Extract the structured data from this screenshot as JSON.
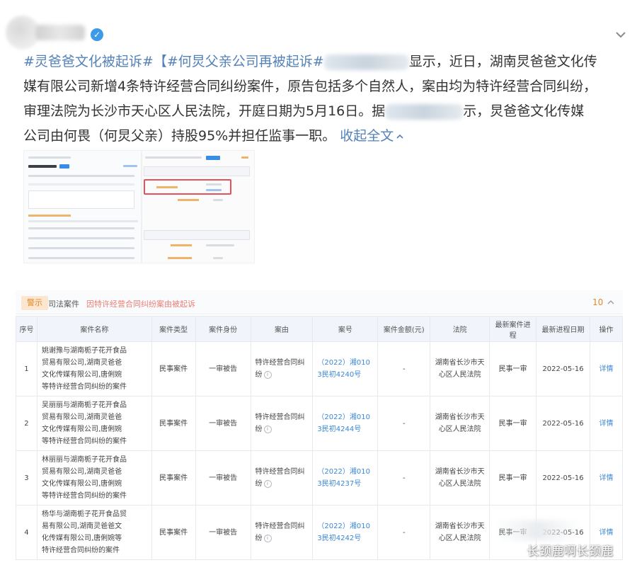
{
  "post": {
    "line1_tag1": "#灵爸爸文化被起诉#",
    "line1_tag2": "【#何炅父亲公司再被起诉#",
    "line1_tail": "显示，近日，湖南炅爸爸文化传",
    "line2": "媒有限公司新增4条特许经营合同纠纷案件，原告包括多个自然人，案由均为特许经营合同纠纷，",
    "line3_head": "审理法院为长沙市天心区人民法院，开庭日期为5月16日。据",
    "line3_tail": "示，炅爸爸文化传媒",
    "line4": "公司由何畏（何炅父亲）持股95%并担任监事一职。",
    "fold_label": "收起全文"
  },
  "header": {
    "verified_icon": "verified-v-icon",
    "expand_icon": "chevron-down-icon"
  },
  "shot": {
    "tab_badge": "警示",
    "tab_1": "司法案件",
    "tab_2": "因特许经营合同纠纷案由被起诉",
    "count": "10",
    "columns": [
      "序号",
      "案件名称",
      "案件类型",
      "案件身份",
      "案由",
      "案号",
      "案件金额(元)",
      "法院",
      "最新案件进程",
      "最新进程日期",
      "操作"
    ],
    "rows": [
      {
        "index": "1",
        "name": [
          "姚谢豫与湖南栀子花开食品",
          "贸易有限公司,湖南灵爸爸",
          "文化传媒有限公司,唐俐婉",
          "等特许经营合同纠纷的案件"
        ],
        "type": "民事案件",
        "role": "一审被告",
        "cause": [
          "特许经营合同纠",
          "纷"
        ],
        "case_no": [
          "（2022）湘010",
          "3民初4240号"
        ],
        "amount": "-",
        "court": [
          "湖南省长沙市天",
          "心区人民法院"
        ],
        "progress": "民事一审",
        "date": "2022-05-16",
        "action": "详情"
      },
      {
        "index": "2",
        "name": [
          "吴丽丽与湖南栀子花开食品",
          "贸易有限公司,湖南灵爸爸",
          "文化传媒有限公司,唐俐婉",
          "等特许经营合同纠纷的案件"
        ],
        "type": "民事案件",
        "role": "一审被告",
        "cause": [
          "特许经营合同纠",
          "纷"
        ],
        "case_no": [
          "（2022）湘010",
          "3民初4244号"
        ],
        "amount": "-",
        "court": [
          "湖南省长沙市天",
          "心区人民法院"
        ],
        "progress": "民事一审",
        "date": "2022-05-16",
        "action": "详情"
      },
      {
        "index": "3",
        "name": [
          "林丽丽与湖南栀子花开食品",
          "贸易有限公司,湖南灵爸爸",
          "文化传媒有限公司,唐俐婉",
          "等特许经营合同纠纷的案件"
        ],
        "type": "民事案件",
        "role": "一审被告",
        "cause": [
          "特许经营合同纠",
          "纷"
        ],
        "case_no": [
          "（2022）湘010",
          "3民初4237号"
        ],
        "amount": "-",
        "court": [
          "湖南省长沙市天",
          "心区人民法院"
        ],
        "progress": "民事一审",
        "date": "2022-05-16",
        "action": "详情"
      },
      {
        "index": "4",
        "name": [
          "杨华与湖南栀子花开食品贸",
          "易有限公司,湖南灵爸爸文",
          "化传媒有限公司,唐俐婉等",
          "特许经营合同纠纷的案件"
        ],
        "type": "民事案件",
        "role": "一审被告",
        "cause": [
          "特许经营合同纠",
          "纷"
        ],
        "case_no": [
          "（2022）湘010",
          "3民初4242号"
        ],
        "amount": "-",
        "court": [
          "湖南省长沙市天",
          "心区人民法院"
        ],
        "progress": "民事一审",
        "date": "2022-05-16",
        "action": "详情"
      }
    ]
  },
  "watermark": "长颈鹿啊长颈鹿"
}
